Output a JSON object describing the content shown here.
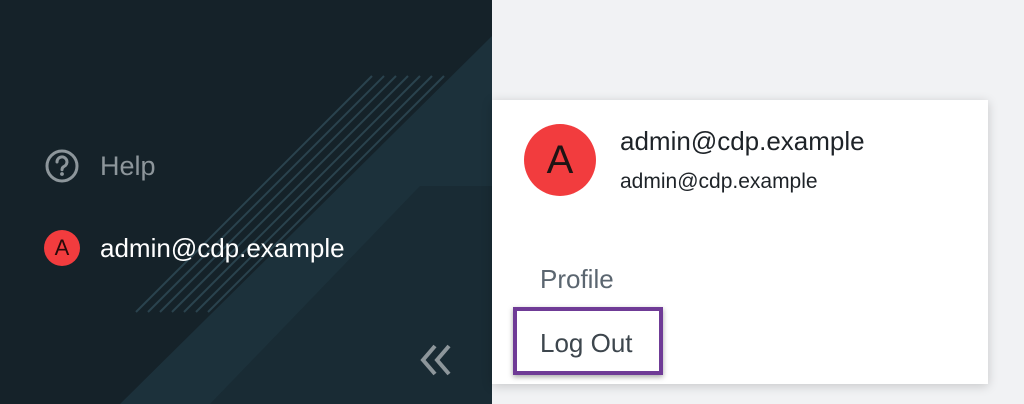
{
  "sidebar": {
    "help_label": "Help",
    "user_initial": "A",
    "user_label": "admin@cdp.example",
    "icons": {
      "help": "help-circle-icon",
      "collapse": "double-chevron-left-icon"
    }
  },
  "user_menu": {
    "avatar_initial": "A",
    "name": "admin@cdp.example",
    "email": "admin@cdp.example",
    "items": [
      {
        "label": "Profile"
      },
      {
        "label": "Log Out"
      }
    ]
  },
  "colors": {
    "sidebar_bg": "#152229",
    "avatar": "#f23c3e",
    "highlight": "#6f3b96",
    "page_bg": "#f1f2f4"
  }
}
